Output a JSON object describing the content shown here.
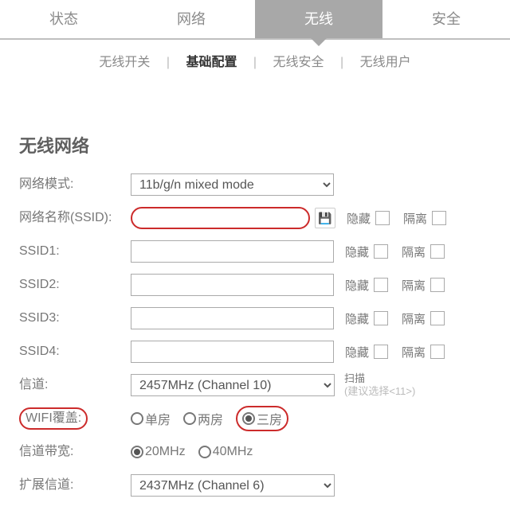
{
  "topnav": {
    "status": "状态",
    "network": "网络",
    "wireless": "无线",
    "security": "安全"
  },
  "subnav": {
    "switch": "无线开关",
    "basic": "基础配置",
    "security": "无线安全",
    "users": "无线用户"
  },
  "section": {
    "title": "无线网络"
  },
  "labels": {
    "mode": "网络模式:",
    "ssid_main": "网络名称(SSID):",
    "ssid1": "SSID1:",
    "ssid2": "SSID2:",
    "ssid3": "SSID3:",
    "ssid4": "SSID4:",
    "channel": "信道:",
    "coverage": "WIFI覆盖:",
    "bandwidth": "信道带宽:",
    "ext_channel": "扩展信道:"
  },
  "checkbox": {
    "hide": "隐藏",
    "isolate": "隔离"
  },
  "values": {
    "mode": "11b/g/n mixed mode",
    "ssid_main": "",
    "ssid1": "",
    "ssid2": "",
    "ssid3": "",
    "ssid4": "",
    "channel": "2457MHz (Channel 10)",
    "ext_channel": "2437MHz (Channel 6)"
  },
  "scan": {
    "label": "扫描",
    "hint": "(建议选择<11>)"
  },
  "coverage": {
    "opt1": "单房",
    "opt2": "两房",
    "opt3": "三房",
    "selected": "三房"
  },
  "bandwidth": {
    "opt1": "20MHz",
    "opt2": "40MHz",
    "selected": "20MHz"
  }
}
